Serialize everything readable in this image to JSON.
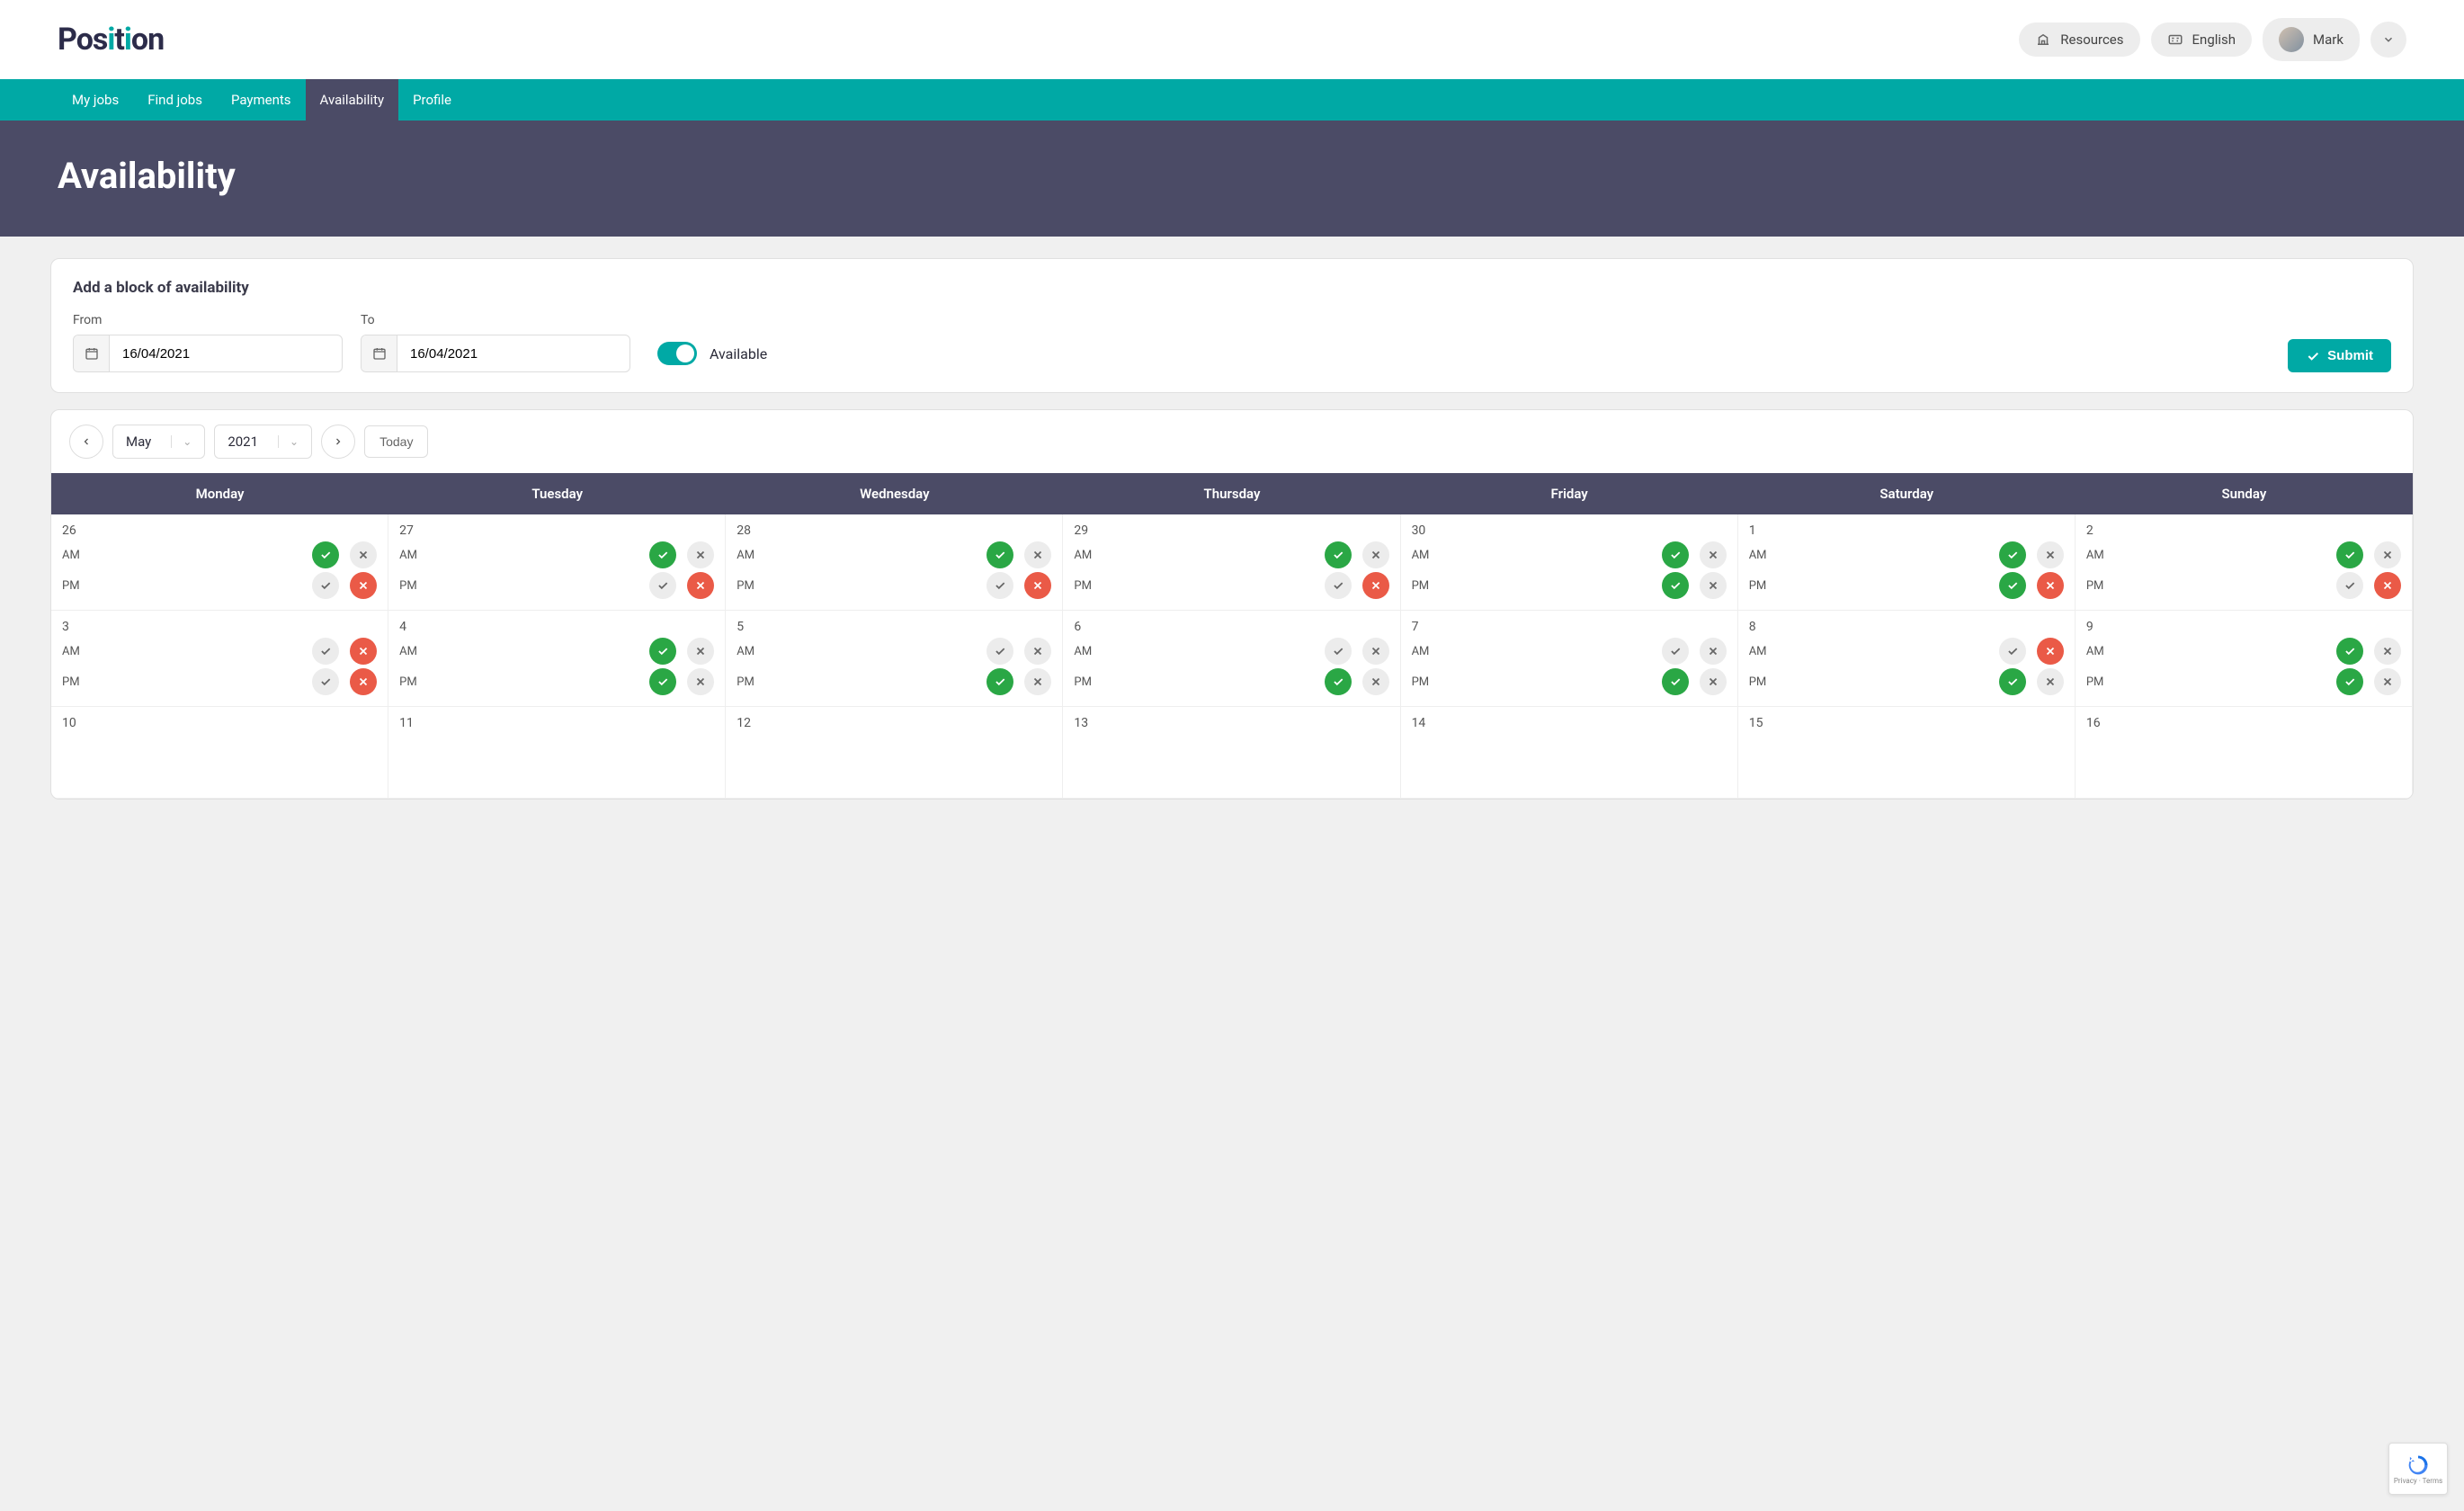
{
  "brand": "Position",
  "header": {
    "resources": "Resources",
    "language": "English",
    "user": "Mark"
  },
  "nav": {
    "items": [
      "My jobs",
      "Find jobs",
      "Payments",
      "Availability",
      "Profile"
    ],
    "active_index": 3
  },
  "page_title": "Availability",
  "block": {
    "title": "Add a block of availability",
    "from_label": "From",
    "to_label": "To",
    "from_value": "16/04/2021",
    "to_value": "16/04/2021",
    "toggle_label": "Available",
    "submit": "Submit"
  },
  "calendar": {
    "month": "May",
    "year": "2021",
    "today": "Today",
    "days": [
      "Monday",
      "Tuesday",
      "Wednesday",
      "Thursday",
      "Friday",
      "Saturday",
      "Sunday"
    ],
    "am": "AM",
    "pm": "PM",
    "cells": [
      {
        "num": "26",
        "am": {
          "c": "g",
          "x": "n"
        },
        "pm": {
          "c": "n",
          "x": "r"
        }
      },
      {
        "num": "27",
        "am": {
          "c": "g",
          "x": "n"
        },
        "pm": {
          "c": "n",
          "x": "r"
        }
      },
      {
        "num": "28",
        "am": {
          "c": "g",
          "x": "n"
        },
        "pm": {
          "c": "n",
          "x": "r"
        }
      },
      {
        "num": "29",
        "am": {
          "c": "g",
          "x": "n"
        },
        "pm": {
          "c": "n",
          "x": "r"
        }
      },
      {
        "num": "30",
        "am": {
          "c": "g",
          "x": "n"
        },
        "pm": {
          "c": "g",
          "x": "n"
        }
      },
      {
        "num": "1",
        "am": {
          "c": "g",
          "x": "n"
        },
        "pm": {
          "c": "g",
          "x": "r"
        }
      },
      {
        "num": "2",
        "am": {
          "c": "g",
          "x": "n"
        },
        "pm": {
          "c": "n",
          "x": "r"
        }
      },
      {
        "num": "3",
        "am": {
          "c": "n",
          "x": "r"
        },
        "pm": {
          "c": "n",
          "x": "r"
        }
      },
      {
        "num": "4",
        "am": {
          "c": "g",
          "x": "n"
        },
        "pm": {
          "c": "g",
          "x": "n"
        }
      },
      {
        "num": "5",
        "am": {
          "c": "n",
          "x": "n"
        },
        "pm": {
          "c": "g",
          "x": "n"
        }
      },
      {
        "num": "6",
        "am": {
          "c": "n",
          "x": "n"
        },
        "pm": {
          "c": "g",
          "x": "n"
        }
      },
      {
        "num": "7",
        "am": {
          "c": "n",
          "x": "n"
        },
        "pm": {
          "c": "g",
          "x": "n"
        }
      },
      {
        "num": "8",
        "am": {
          "c": "n",
          "x": "r"
        },
        "pm": {
          "c": "g",
          "x": "n"
        }
      },
      {
        "num": "9",
        "am": {
          "c": "g",
          "x": "n"
        },
        "pm": {
          "c": "g",
          "x": "n"
        }
      },
      {
        "num": "10",
        "am": {
          "c": "",
          "x": ""
        },
        "pm": {
          "c": "",
          "x": ""
        }
      },
      {
        "num": "11",
        "am": {
          "c": "",
          "x": ""
        },
        "pm": {
          "c": "",
          "x": ""
        }
      },
      {
        "num": "12",
        "am": {
          "c": "",
          "x": ""
        },
        "pm": {
          "c": "",
          "x": ""
        }
      },
      {
        "num": "13",
        "am": {
          "c": "",
          "x": ""
        },
        "pm": {
          "c": "",
          "x": ""
        }
      },
      {
        "num": "14",
        "am": {
          "c": "",
          "x": ""
        },
        "pm": {
          "c": "",
          "x": ""
        }
      },
      {
        "num": "15",
        "am": {
          "c": "",
          "x": ""
        },
        "pm": {
          "c": "",
          "x": ""
        }
      },
      {
        "num": "16",
        "am": {
          "c": "",
          "x": ""
        },
        "pm": {
          "c": "",
          "x": ""
        }
      }
    ]
  },
  "recaptcha": {
    "privacy": "Privacy",
    "terms": "Terms"
  }
}
